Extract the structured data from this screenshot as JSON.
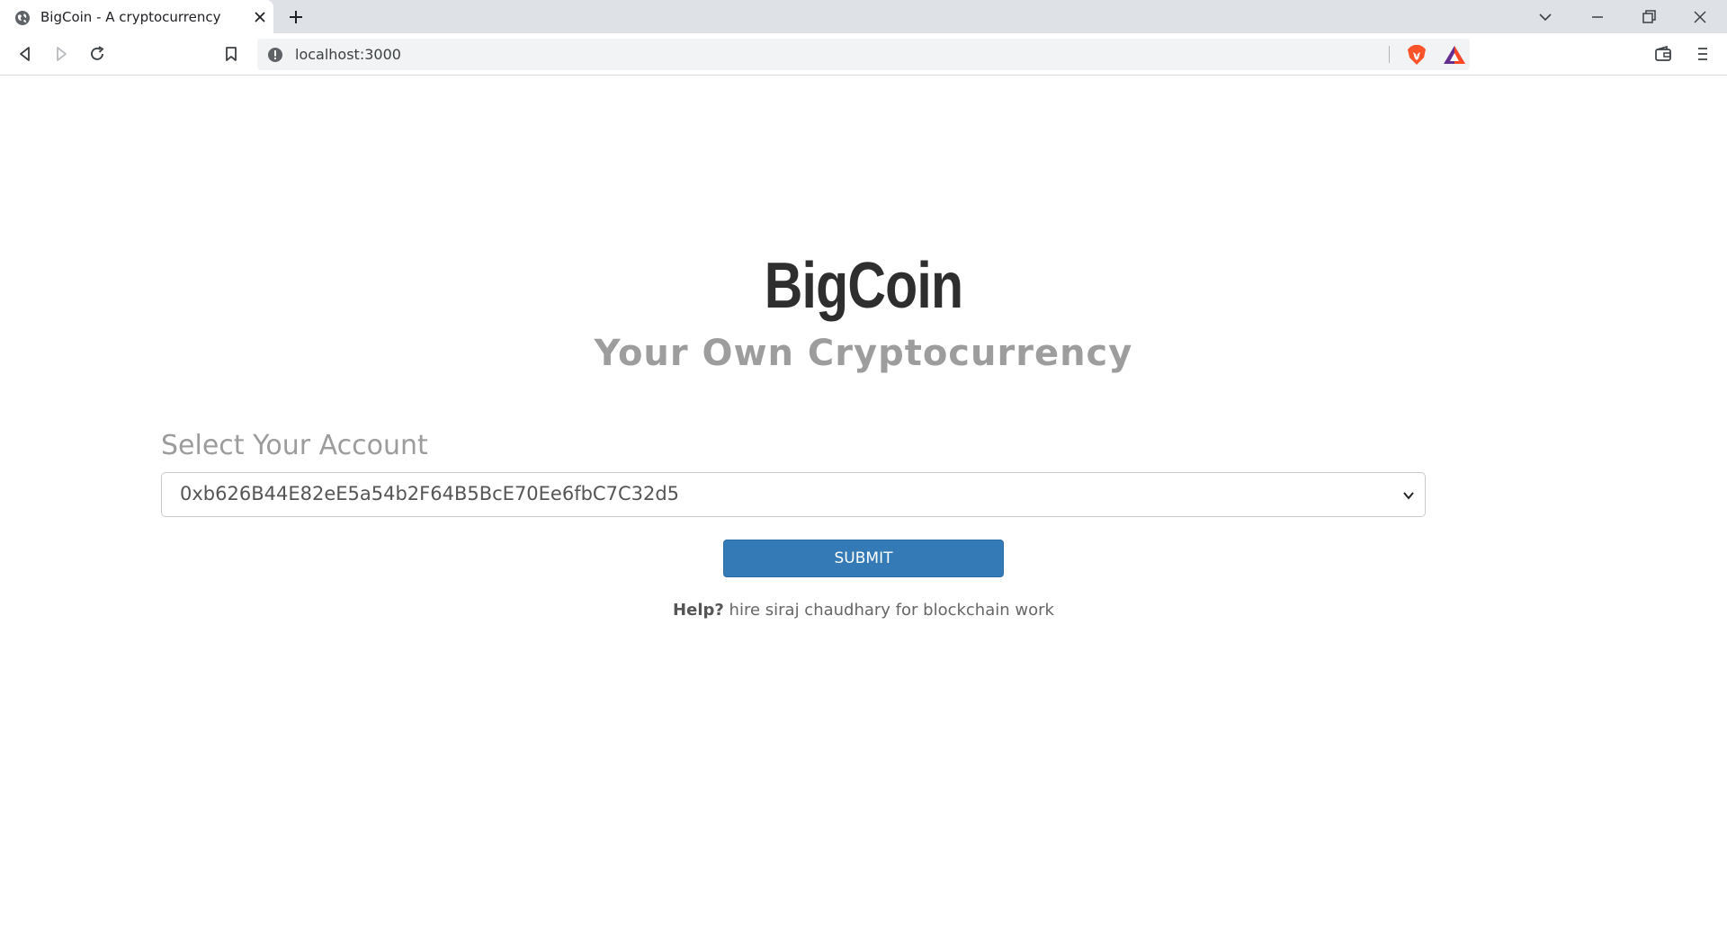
{
  "browser": {
    "tab_title": "BigCoin - A cryptocurrency",
    "url": "localhost:3000"
  },
  "icons": {
    "favicon": "globe-icon",
    "tab_close": "close-icon",
    "new_tab": "plus-icon",
    "tab_search": "chevron-down-icon",
    "minimize": "minimize-icon",
    "restore": "restore-icon",
    "close_window": "close-icon",
    "back": "back-icon",
    "forward": "forward-icon",
    "reload": "reload-icon",
    "bookmark": "bookmark-icon",
    "site_info": "info-icon",
    "brave_shields": "brave-lion-icon",
    "rewards": "bat-triangle-icon",
    "wallet": "wallet-icon",
    "menu": "hamburger-menu-icon"
  },
  "colors": {
    "submit_bg": "#337ab7",
    "title": "#2e2e2e",
    "subtitle": "#9d9d9d",
    "brave_orange": "#fb542b"
  },
  "page": {
    "title": "BigCoin",
    "subtitle": "Your Own Cryptocurrency",
    "account_label": "Select Your Account",
    "selected_account": "0xb626B44E82eE5a54b2F64B5BcE70Ee6fbC7C32d5",
    "submit_label": "SUBMIT",
    "help_label": "Help?",
    "help_text": " hire siraj chaudhary for blockchain work"
  }
}
